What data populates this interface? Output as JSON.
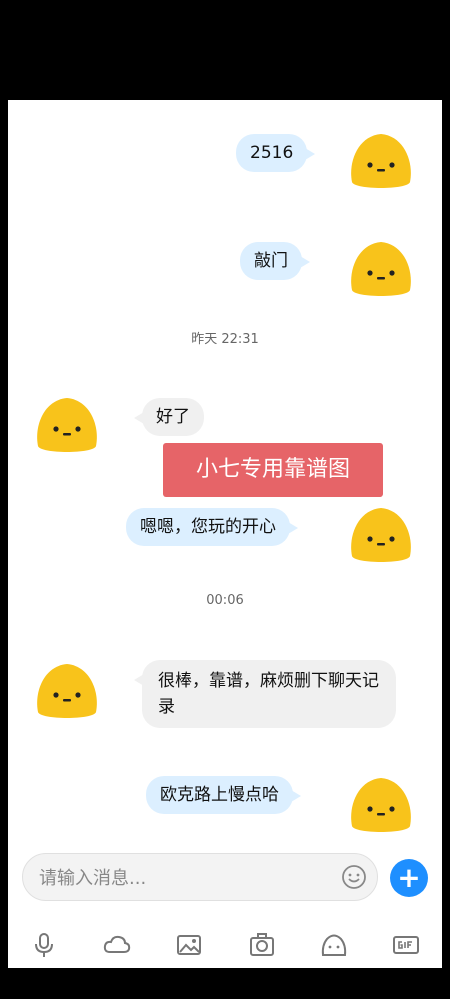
{
  "messages": [
    {
      "text": "2516",
      "from": "me"
    },
    {
      "text": "敲门",
      "from": "me"
    },
    {
      "text": "好了",
      "from": "them"
    },
    {
      "text": "嗯嗯，您玩的开心",
      "from": "me"
    },
    {
      "text": "很棒，靠谱，麻烦删下聊天记录",
      "from": "them"
    },
    {
      "text": "欧克路上慢点哈",
      "from": "me"
    }
  ],
  "timestamps": [
    "昨天 22:31",
    "00:06"
  ],
  "banner": {
    "text": "小七专用靠谱图",
    "color": "#e66468"
  },
  "input": {
    "placeholder": "请输入消息..."
  },
  "colors": {
    "accent": "#1e8fff",
    "avatar": "#f8c31b",
    "bubble_me": "#dcefff",
    "bubble_them": "#f0f0f0"
  },
  "toolbar": [
    "mic-icon",
    "cloud-icon",
    "image-icon",
    "camera-icon",
    "emoji-icon",
    "gif-icon"
  ]
}
